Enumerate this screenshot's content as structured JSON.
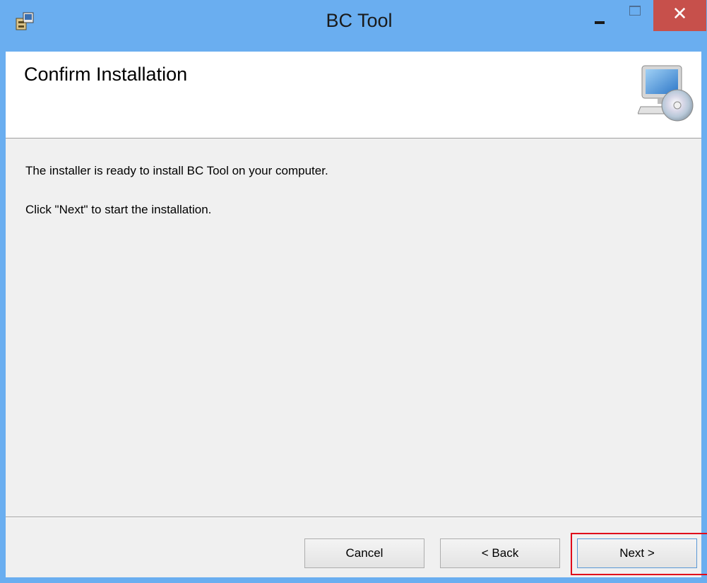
{
  "window": {
    "title": "BC Tool",
    "controls": {
      "close": "✕"
    }
  },
  "header": {
    "title": "Confirm Installation"
  },
  "body": {
    "line1": "The installer is ready to install BC Tool on your computer.",
    "line2": "Click \"Next\" to start the installation."
  },
  "buttons": {
    "cancel": "Cancel",
    "back": "< Back",
    "next": "Next >"
  },
  "icons": {
    "app": "installer-package-icon",
    "header": "computer-disc-icon"
  },
  "colors": {
    "titlebar": "#6aaef0",
    "close": "#c7504b",
    "highlight": "#e0001a"
  }
}
